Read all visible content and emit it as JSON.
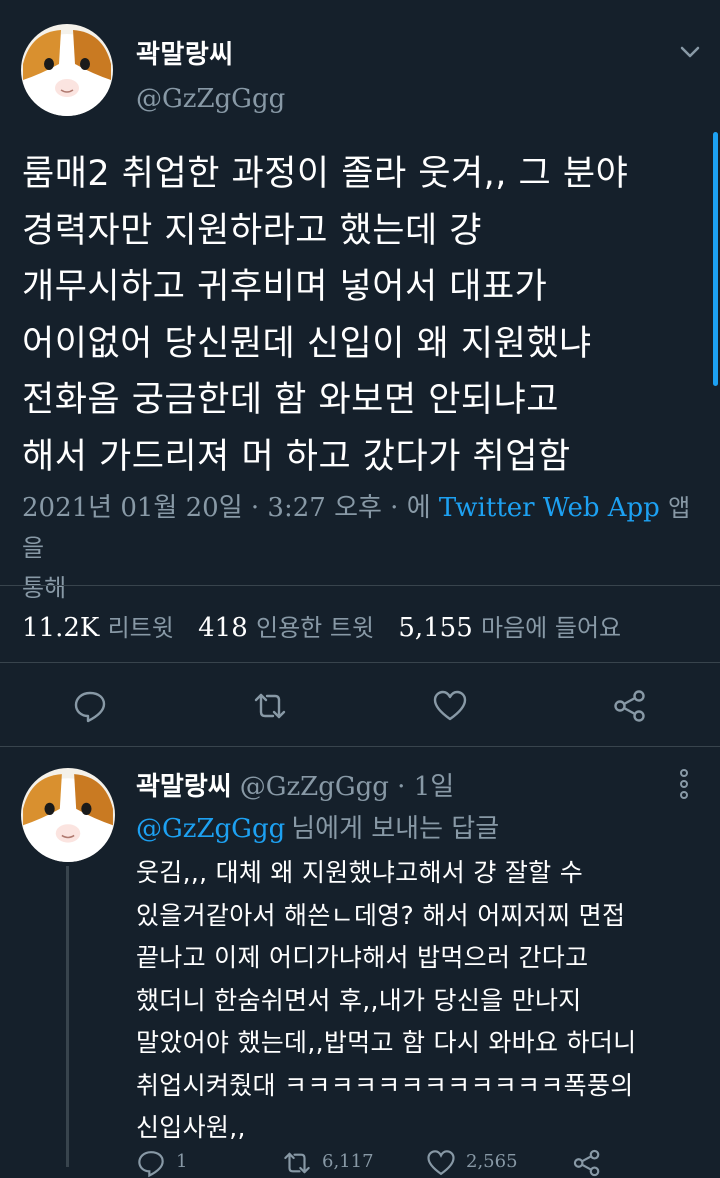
{
  "main_tweet": {
    "author_name": "곽말랑씨",
    "author_handle": "@GzZgGgg",
    "body": "룸매2 취업한 과정이 졸라 웃겨,, 그 분야\n경력자만 지원하라고 했는데 걍\n개무시하고 귀후비며 넣어서 대표가\n어이없어 당신뭔데 신입이 왜 지원했냐\n전화옴 궁금한데 함 와보면 안되냐고\n해서 가드리져 머 하고 갔다가 취업함",
    "timestamp": "2021년 01월 20일 · 3:27 오후 · 에",
    "source_app": "Twitter Web App",
    "source_suffix": "앱을\n통해",
    "stats": {
      "retweets_value": "11.2K",
      "retweets_label": "리트윗",
      "quotes_value": "418",
      "quotes_label": "인용한 트윗",
      "likes_value": "5,155",
      "likes_label": "마음에 들어요"
    },
    "action_icons": [
      "reply-icon",
      "retweet-icon",
      "like-icon",
      "share-icon"
    ]
  },
  "reply": {
    "author_name": "곽말랑씨",
    "author_handle": "@GzZgGgg · 1일",
    "replying_to_handle": "@GzZgGgg",
    "replying_to_text": "님에게 보내는 답글",
    "body": "웃김,,, 대체 왜 지원했냐고해서 걍 잘할 수\n있을거같아서 해쓴ㄴ데영? 해서 어찌저찌 면접\n끝나고 이제 어디가냐해서 밥먹으러 간다고\n했더니 한숨쉬면서 후,,내가 당신을 만나지\n말았어야 했는데,,밥먹고 함 다시 와바요 하더니\n취업시켜줬대 ㅋㅋㅋㅋㅋㅋㅋㅋㅋㅋㅋㅋ폭풍의\n신입사원,,",
    "reply_count": "1",
    "retweet_count": "6,117",
    "like_count": "2,565"
  },
  "colors": {
    "background": "#15202b",
    "text": "#ffffff",
    "muted": "#8899a6",
    "link": "#1da1f2",
    "divider": "#38444d"
  }
}
